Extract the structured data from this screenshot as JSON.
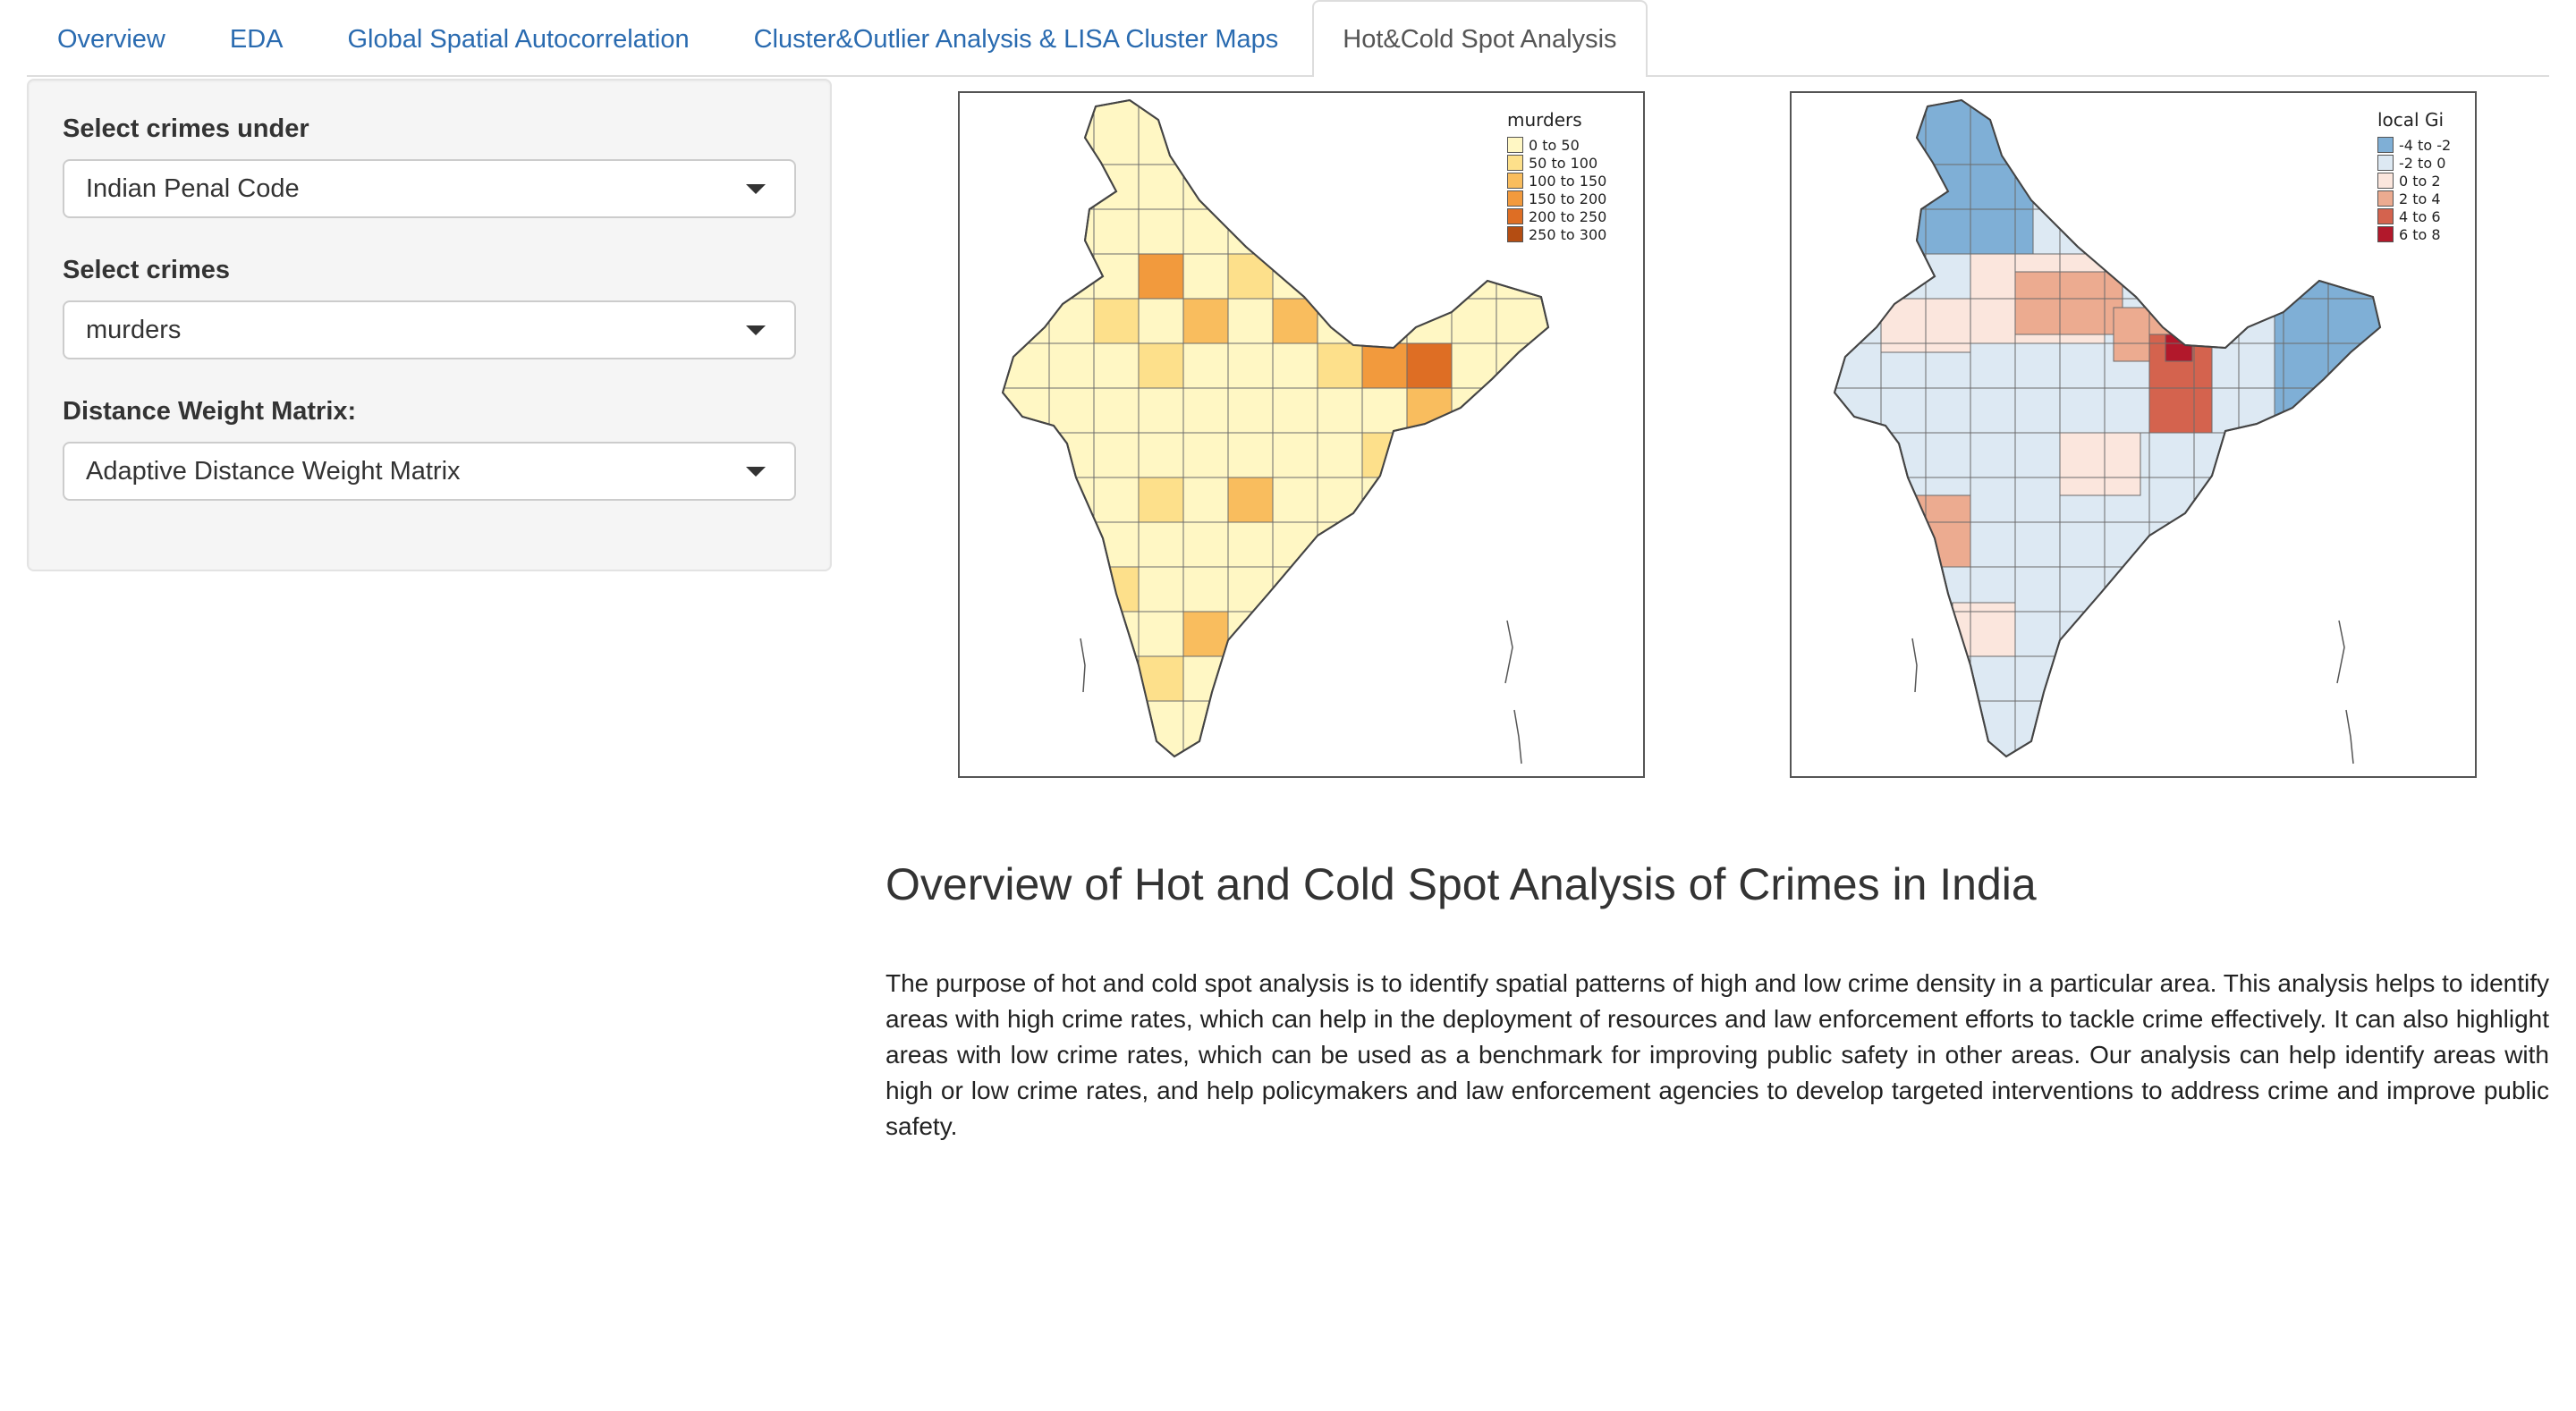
{
  "tabs": [
    {
      "label": "Overview",
      "active": false
    },
    {
      "label": "EDA",
      "active": false
    },
    {
      "label": "Global Spatial Autocorrelation",
      "active": false
    },
    {
      "label": "Cluster&Outlier Analysis & LISA Cluster Maps",
      "active": false
    },
    {
      "label": "Hot&Cold Spot Analysis",
      "active": true
    }
  ],
  "sidebar": {
    "crime_category_label": "Select crimes under",
    "crime_category_value": "Indian Penal Code",
    "crime_label": "Select crimes",
    "crime_value": "murders",
    "weight_label": "Distance Weight Matrix:",
    "weight_value": "Adaptive Distance Weight Matrix"
  },
  "maps": {
    "murders": {
      "legend_title": "murders",
      "legend": [
        {
          "label": "0 to 50",
          "color": "#fff7c4"
        },
        {
          "label": "50 to 100",
          "color": "#fde08b"
        },
        {
          "label": "100 to 150",
          "color": "#f9bd5e"
        },
        {
          "label": "150 to 200",
          "color": "#f29a3d"
        },
        {
          "label": "200 to 250",
          "color": "#de6e24"
        },
        {
          "label": "250 to 300",
          "color": "#b44d12"
        }
      ]
    },
    "gi": {
      "legend_title": "local Gi",
      "legend": [
        {
          "label": "-4 to -2",
          "color": "#7fafd6"
        },
        {
          "label": "-2 to 0",
          "color": "#dde9f3"
        },
        {
          "label": "0 to 2",
          "color": "#fbe6dd"
        },
        {
          "label": "2 to 4",
          "color": "#ecab90"
        },
        {
          "label": "4 to 6",
          "color": "#d4634e"
        },
        {
          "label": "6 to 8",
          "color": "#b2182b"
        }
      ]
    }
  },
  "overview": {
    "title": "Overview of Hot and Cold Spot Analysis of Crimes in India",
    "text": "The purpose of hot and cold spot analysis is to identify spatial patterns of high and low crime density in a particular area. This analysis helps to identify areas with high crime rates, which can help in the deployment of resources and law enforcement efforts to tackle crime effectively. It can also highlight areas with low crime rates, which can be used as a benchmark for improving public safety in other areas. Our analysis can help identify areas with high or low crime rates, and help policymakers and law enforcement agencies to develop targeted interventions to address crime and improve public safety."
  }
}
